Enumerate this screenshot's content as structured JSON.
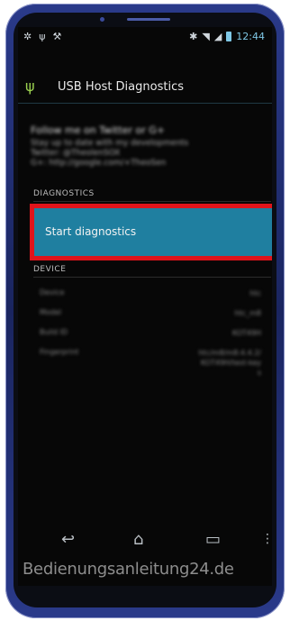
{
  "statusbar": {
    "time": "12:44"
  },
  "app": {
    "title": "USB Host Diagnostics"
  },
  "about": {
    "title": "Follow me on Twitter or G+",
    "lines": [
      "Stay up to date with my developments",
      "Twitter: @TheolenSOX",
      "G+: http://google.com/+TheoSen"
    ]
  },
  "sections": {
    "diagnostics": "DIAGNOSTICS",
    "device": "DEVICE"
  },
  "start_item": {
    "label": "Start diagnostics"
  },
  "device": {
    "rows": [
      {
        "key": "Device",
        "value": "htc"
      },
      {
        "key": "Model",
        "value": "htc_m8"
      },
      {
        "key": "Build ID",
        "value": "KOT49H"
      },
      {
        "key": "Fingerprint",
        "value": "htc/m8/m8:4.4.2/KOT49H/test-keys"
      }
    ]
  },
  "nav": {
    "back": "back-icon",
    "home": "home-icon",
    "recent": "recent-apps-icon",
    "menu": "overflow-menu-icon"
  },
  "watermark": "Bedienungsanleitung24.de",
  "colors": {
    "highlight_border": "#e0141b",
    "item_bg": "#1f7fa0",
    "usb_icon": "#9ad04f",
    "phone_frame": "#1a2560"
  }
}
